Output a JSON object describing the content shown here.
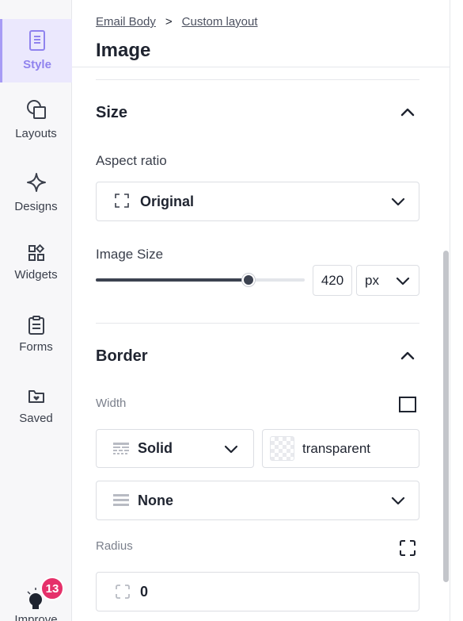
{
  "sidebar": {
    "items": [
      {
        "label": "Style",
        "icon": "style-doc-icon",
        "active": true
      },
      {
        "label": "Layouts",
        "icon": "layouts-shapes-icon"
      },
      {
        "label": "Designs",
        "icon": "sparkle-icon"
      },
      {
        "label": "Widgets",
        "icon": "widgets-grid-icon"
      },
      {
        "label": "Forms",
        "icon": "clipboard-icon"
      },
      {
        "label": "Saved",
        "icon": "folder-heart-icon"
      }
    ],
    "improve": {
      "label": "Improve",
      "badge": "13",
      "icon": "lightbulb-icon"
    }
  },
  "header": {
    "breadcrumb": [
      "Email Body",
      "Custom layout"
    ],
    "separator": ">",
    "title": "Image"
  },
  "size_section": {
    "title": "Size",
    "aspect_ratio": {
      "label": "Aspect ratio",
      "value": "Original"
    },
    "image_size": {
      "label": "Image Size",
      "value": "420",
      "unit": "px",
      "slider_fraction": 0.73
    }
  },
  "border_section": {
    "title": "Border",
    "width_label": "Width",
    "style_value": "Solid",
    "color_value": "transparent",
    "side_value": "None",
    "radius_label": "Radius",
    "radius_value": "0"
  },
  "colors": {
    "accent": "#9083ee",
    "badge": "#e5306a",
    "slider": "#3c4250"
  }
}
